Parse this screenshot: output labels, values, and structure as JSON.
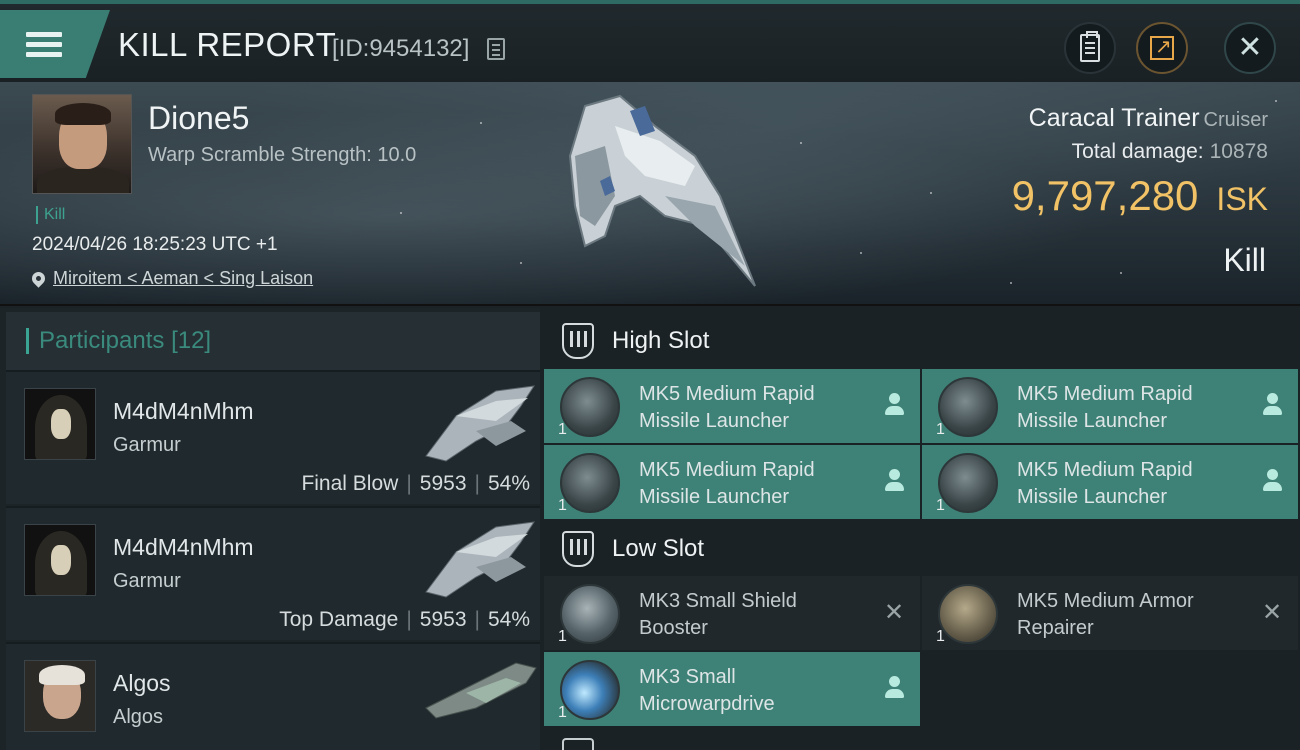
{
  "header": {
    "title": "KILL REPORT",
    "report_id": "[ID:9454132]"
  },
  "victim": {
    "name": "Dione5",
    "warp_scramble": "Warp Scramble Strength: 10.0",
    "tag": "Kill",
    "time": "2024/04/26 18:25:23 UTC +1",
    "location": "Miroitem < Aeman < Sing Laison"
  },
  "ship": {
    "name": "Caracal Trainer",
    "class": "Cruiser",
    "total_damage_label": "Total damage:",
    "total_damage": "10878",
    "isk_value": "9,797,280",
    "isk_unit": "ISK",
    "result": "Kill"
  },
  "participants": {
    "label": "Participants",
    "count": "[12]",
    "rows": [
      {
        "name": "M4dM4nMhm",
        "ship": "Garmur",
        "role": "Final Blow",
        "damage": "5953",
        "percent": "54%"
      },
      {
        "name": "M4dM4nMhm",
        "ship": "Garmur",
        "role": "Top Damage",
        "damage": "5953",
        "percent": "54%"
      },
      {
        "name": "Algos",
        "ship": "Algos"
      }
    ]
  },
  "fitting": {
    "high_slot_label": "High Slot",
    "low_slot_label": "Low Slot",
    "high": [
      {
        "line1": "MK5 Medium Rapid",
        "line2": "Missile Launcher",
        "qty": "1",
        "status": "fitted"
      },
      {
        "line1": "MK5 Medium Rapid",
        "line2": "Missile Launcher",
        "qty": "1",
        "status": "fitted"
      },
      {
        "line1": "MK5 Medium Rapid",
        "line2": "Missile Launcher",
        "qty": "1",
        "status": "fitted"
      },
      {
        "line1": "MK5 Medium Rapid",
        "line2": "Missile Launcher",
        "qty": "1",
        "status": "fitted"
      }
    ],
    "low": [
      {
        "line1": "MK3 Small Shield",
        "line2": "Booster",
        "qty": "1",
        "status": "destroyed"
      },
      {
        "line1": "MK5 Medium Armor",
        "line2": "Repairer",
        "qty": "1",
        "status": "destroyed"
      },
      {
        "line1": "MK3 Small",
        "line2": "Microwarpdrive",
        "qty": "1",
        "status": "fitted"
      }
    ]
  },
  "colors": {
    "accent": "#3e8176",
    "isk": "#f1c266",
    "participants_label": "#3a8a7d"
  }
}
